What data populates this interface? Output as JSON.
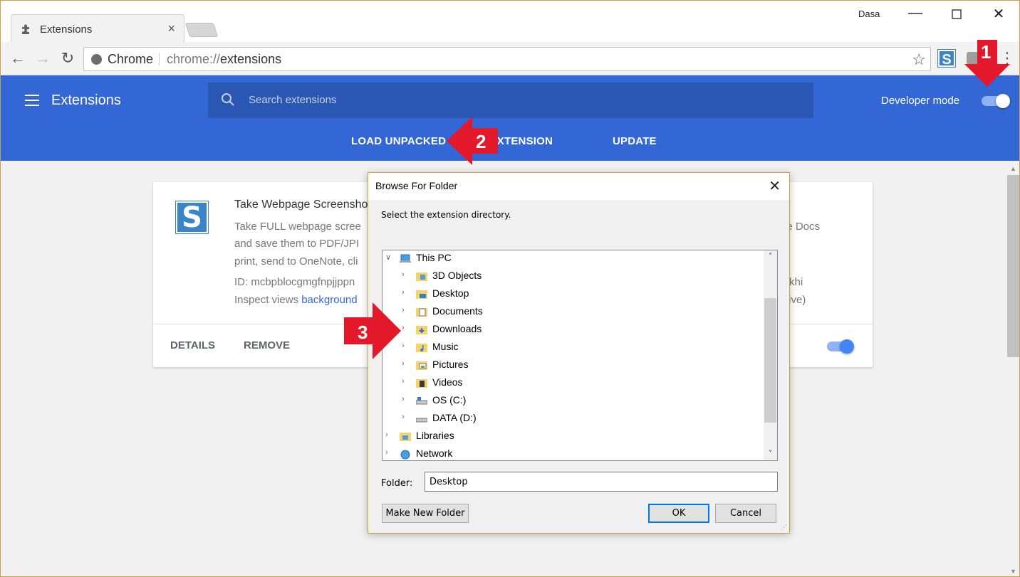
{
  "browser": {
    "tab_title": "Extensions",
    "profile_name": "Dasa",
    "omnibox_scheme_label": "Chrome",
    "omnibox_url_prefix": "chrome://",
    "omnibox_url_path": "extensions"
  },
  "extensions_header": {
    "title": "Extensions",
    "search_placeholder": "Search extensions",
    "developer_mode_label": "Developer mode",
    "developer_mode_on": true,
    "actions": [
      "LOAD UNPACKED",
      "PACK EXTENSION",
      "UPDATE"
    ]
  },
  "extension_card": {
    "logo_letter": "S",
    "name": "Take Webpage Screensho",
    "description_lines": [
      "Take FULL webpage scree",
      "and save them to PDF/JPI",
      "print, send to OneNote, cli"
    ],
    "description_right": "le Docs",
    "id_line": "ID: mcbpblocgmgfnpjjppn",
    "id_right": "khi",
    "inspect_label": "Inspect views",
    "inspect_link": "background",
    "inspect_right": "tive)",
    "details_label": "DETAILS",
    "remove_label": "REMOVE",
    "enabled": true
  },
  "dialog": {
    "title": "Browse For Folder",
    "instruction": "Select the extension directory.",
    "tree": [
      {
        "label": "This PC",
        "level": 0,
        "expanded": true,
        "icon": "pc-icon"
      },
      {
        "label": "3D Objects",
        "level": 1,
        "icon": "3d-objects-folder-icon"
      },
      {
        "label": "Desktop",
        "level": 1,
        "icon": "desktop-folder-icon"
      },
      {
        "label": "Documents",
        "level": 1,
        "icon": "documents-folder-icon"
      },
      {
        "label": "Downloads",
        "level": 1,
        "icon": "downloads-folder-icon"
      },
      {
        "label": "Music",
        "level": 1,
        "icon": "music-folder-icon"
      },
      {
        "label": "Pictures",
        "level": 1,
        "icon": "pictures-folder-icon"
      },
      {
        "label": "Videos",
        "level": 1,
        "icon": "videos-folder-icon"
      },
      {
        "label": "OS (C:)",
        "level": 1,
        "icon": "drive-icon"
      },
      {
        "label": "DATA (D:)",
        "level": 1,
        "icon": "drive-icon"
      },
      {
        "label": "Libraries",
        "level": 0,
        "icon": "libraries-folder-icon"
      },
      {
        "label": "Network",
        "level": 0,
        "icon": "network-icon"
      }
    ],
    "folder_label": "Folder:",
    "folder_value": "Desktop",
    "make_new_folder": "Make New Folder",
    "ok": "OK",
    "cancel": "Cancel"
  },
  "annotations": [
    "1",
    "2",
    "3"
  ],
  "colors": {
    "header_blue": "#3367d6",
    "annotation_red": "#e3182b",
    "toggle_blue": "#4285f4"
  }
}
